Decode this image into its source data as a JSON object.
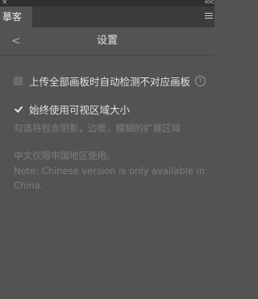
{
  "window": {
    "close_glyph": "×",
    "collapse_glyph": "<<"
  },
  "tab": {
    "label": "摹客"
  },
  "menu_icon": "hamburger-menu-icon",
  "header": {
    "back_glyph": "<",
    "title": "设置"
  },
  "options": [
    {
      "label": "上传全部画板时自动检测不对应画板",
      "checked": false,
      "help_glyph": "?"
    },
    {
      "label": "始终使用可视区域大小",
      "checked": true,
      "description": "勾选将包含阴影，边框，模糊的扩展区域"
    }
  ],
  "notice": {
    "line1": "中文仅限中国地区使用。",
    "line2": "Note: Chinese version is only available in",
    "line3": "China."
  }
}
